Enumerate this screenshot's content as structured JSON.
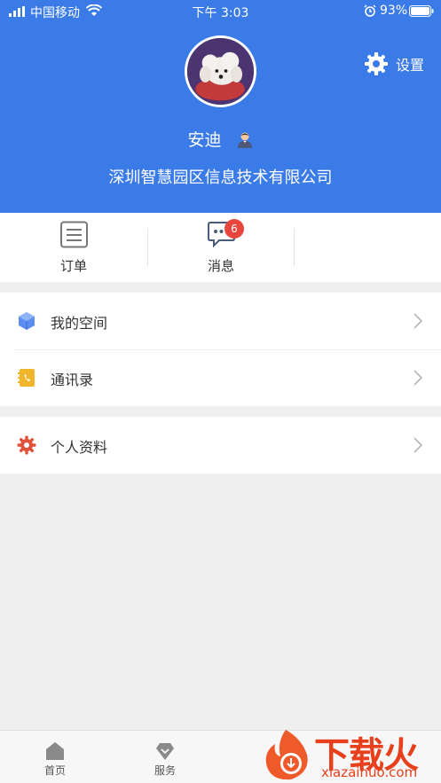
{
  "status_bar": {
    "carrier": "中国移动",
    "time": "下午 3:03",
    "battery": "93%"
  },
  "header": {
    "settings_label": "设置",
    "user_name": "安迪",
    "company": "深圳智慧园区信息技术有限公司"
  },
  "tabs": {
    "orders_label": "订单",
    "messages_label": "消息",
    "messages_badge": "6"
  },
  "menu": {
    "group1": [
      {
        "label": "我的空间",
        "icon": "cube-icon"
      },
      {
        "label": "通讯录",
        "icon": "contacts-icon"
      }
    ],
    "group2": [
      {
        "label": "个人资料",
        "icon": "gear-icon"
      }
    ]
  },
  "bottom_nav": {
    "home_label": "首页",
    "services_label": "服务"
  },
  "watermark": {
    "main": "下载火",
    "sub": "xiazaihuo.com"
  },
  "colors": {
    "header_bg": "#3b7be8",
    "badge": "#e8463c",
    "accent_red": "#e8401c"
  }
}
